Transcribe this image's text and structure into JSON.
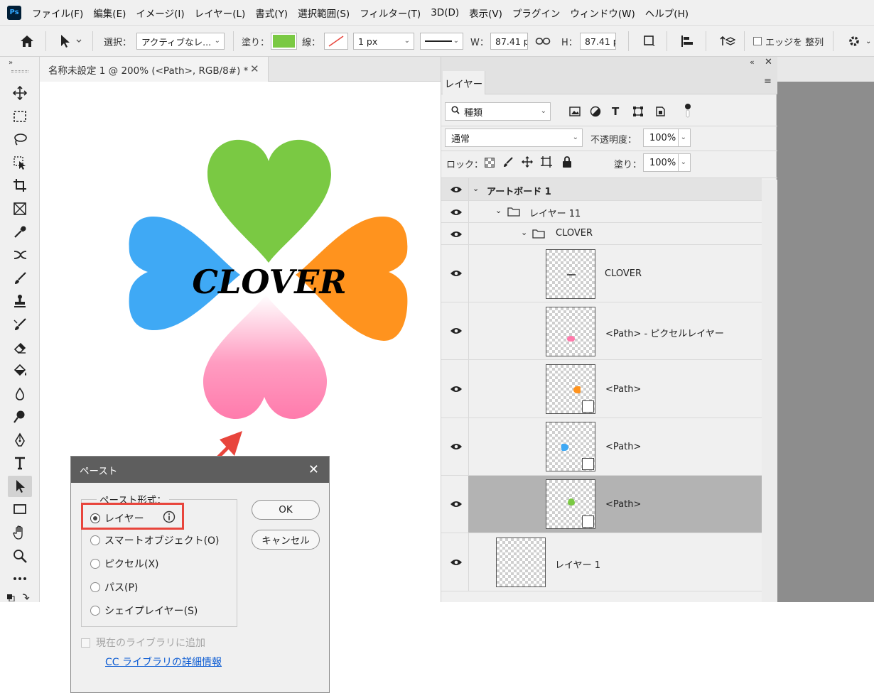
{
  "app": {
    "logo": "Ps"
  },
  "menu": [
    "ファイル(F)",
    "編集(E)",
    "イメージ(I)",
    "レイヤー(L)",
    "書式(Y)",
    "選択範囲(S)",
    "フィルター(T)",
    "3D(D)",
    "表示(V)",
    "プラグイン",
    "ウィンドウ(W)",
    "ヘルプ(H)"
  ],
  "options": {
    "select_label": "選択：",
    "select_value": "アクティブなレ...",
    "fill_label": "塗り：",
    "fill_color": "#7ac943",
    "stroke_label": "線：",
    "stroke_width": "1 px",
    "w_label": "W：",
    "w_value": "87.41 p",
    "h_label": "H：",
    "h_value": "87.41 p",
    "align_edges": "エッジを 整列"
  },
  "document": {
    "tab_title": "名称未設定 1 @ 200% (<Path>, RGB/8#) *"
  },
  "artwork": {
    "text": "CLOVER",
    "colors": {
      "green": "#7ac943",
      "blue": "#3fa9f5",
      "orange": "#ff931e",
      "pink": "#ff7bac"
    }
  },
  "layers_panel": {
    "tab": "レイヤー",
    "filter_value": "種類",
    "blend_mode": "通常",
    "opacity_label": "不透明度：",
    "opacity_value": "100%",
    "lock_label": "ロック：",
    "fill_label": "塗り：",
    "fill_value": "100%",
    "rows": [
      {
        "name": "アートボード 1",
        "kind": "artboard"
      },
      {
        "name": "レイヤー 11",
        "kind": "group"
      },
      {
        "name": "CLOVER",
        "kind": "group"
      },
      {
        "name": "CLOVER",
        "kind": "layer",
        "thumb": "text"
      },
      {
        "name": "<Path> - ピクセルレイヤー",
        "kind": "layer",
        "thumb": "pink"
      },
      {
        "name": "<Path>",
        "kind": "layer",
        "thumb": "orange"
      },
      {
        "name": "<Path>",
        "kind": "layer",
        "thumb": "blue"
      },
      {
        "name": "<Path>",
        "kind": "layer",
        "thumb": "green",
        "selected": true
      },
      {
        "name": "レイヤー 1",
        "kind": "layer",
        "thumb": "empty"
      }
    ]
  },
  "dialog": {
    "title": "ペースト",
    "group_label": "ペースト形式：",
    "options": [
      "レイヤー",
      "スマートオブジェクト(O)",
      "ピクセル(X)",
      "パス(P)",
      "シェイプレイヤー(S)"
    ],
    "selected_option": "レイヤー",
    "ok": "OK",
    "cancel": "キャンセル",
    "add_to_library": "現在のライブラリに追加",
    "cc_link": "CC ライブラリの詳細情報",
    "highlight_color": "#e8453c"
  }
}
